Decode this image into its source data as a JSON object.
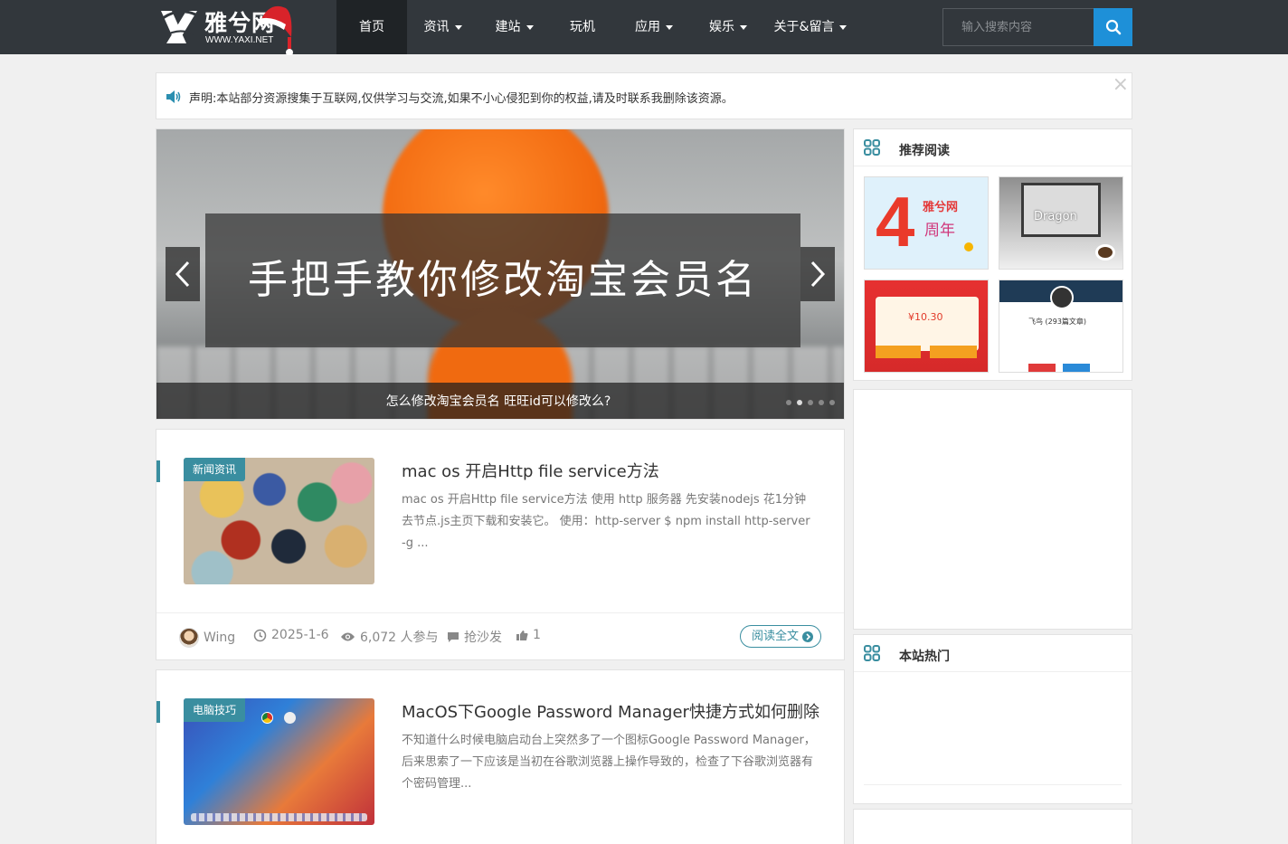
{
  "header": {
    "logo_cn": "雅兮网",
    "logo_en": "WWW.YAXI.NET",
    "nav": [
      {
        "label": "首页",
        "active": true,
        "dropdown": false
      },
      {
        "label": "资讯",
        "active": false,
        "dropdown": true
      },
      {
        "label": "建站",
        "active": false,
        "dropdown": true
      },
      {
        "label": "玩机",
        "active": false,
        "dropdown": false
      },
      {
        "label": "应用",
        "active": false,
        "dropdown": true
      },
      {
        "label": "娱乐",
        "active": false,
        "dropdown": true
      },
      {
        "label": "关于&留言",
        "active": false,
        "dropdown": true
      }
    ],
    "search_placeholder": "输入搜索内容"
  },
  "notice": {
    "text": "声明:本站部分资源搜集于互联网,仅供学习与交流,如果不小心侵犯到你的权益,请及时联系我删除该资源。",
    "close": "×"
  },
  "slider": {
    "caption": "手把手教你修改淘宝会员名",
    "title": "怎么修改淘宝会员名 旺旺id可以修改么?",
    "dots": 5,
    "active_dot": 2
  },
  "posts": [
    {
      "category": "新闻资讯",
      "title": "mac os 开启Http file service方法",
      "excerpt": "mac os 开启Http file service方法 使用 http 服务器 先安装nodejs 花1分钟去节点.js主页下载和安装它。 使用：http-server $ npm install http-server -g ...",
      "author": "Wing",
      "date": "2025-1-6",
      "views": "6,072 人参与",
      "comments": "抢沙发",
      "likes": "1",
      "read_more": "阅读全文"
    },
    {
      "category": "电脑技巧",
      "title": "MacOS下Google Password Manager快捷方式如何删除",
      "excerpt": "不知道什么时候电脑启动台上突然多了一个图标Google Password Manager，后来思索了一下应该是当初在谷歌浏览器上操作导致的，检查了下谷歌浏览器有个密码管理..."
    }
  ],
  "sidebar": {
    "recommended_title": "推荐阅读",
    "hot_title": "本站热门",
    "thumb_texts": {
      "anniv_brand": "雅兮网",
      "anniv_label": "周年",
      "dragon": "Dragon",
      "redpacket_amount": "¥10.30",
      "profile_name": "飞鸟 (293篇文章)"
    }
  },
  "colors": {
    "header_bg": "#32373c",
    "accent": "#3a8ea0",
    "search_btn": "#1e90d8"
  }
}
